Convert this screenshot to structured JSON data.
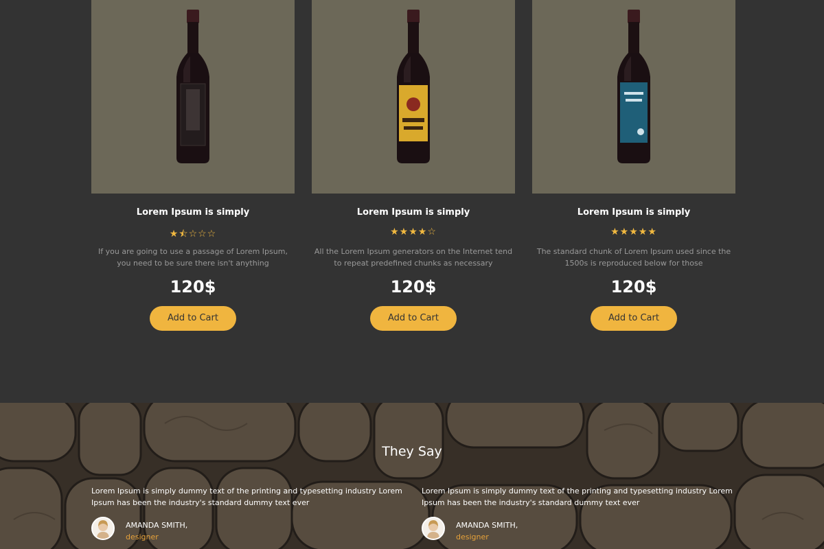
{
  "products": [
    {
      "title": "Lorem Ipsum is simply",
      "rating": 1.5,
      "stars": "★⯪☆☆☆",
      "description": "If you are going to use a passage of Lorem Ipsum, you need to be sure there isn't anything",
      "price": "120$",
      "button": "Add to Cart",
      "label_color": "#1b1b1b"
    },
    {
      "title": "Lorem Ipsum is simply",
      "rating": 4,
      "stars": "★★★★☆",
      "description": "All the Lorem Ipsum generators on the Internet tend to repeat predefined chunks as necessary",
      "price": "120$",
      "button": "Add to Cart",
      "label_color": "#d9a92c"
    },
    {
      "title": "Lorem Ipsum is simply",
      "rating": 5,
      "stars": "★★★★★",
      "description": "The standard chunk of Lorem Ipsum used since the 1500s is reproduced below for those",
      "price": "120$",
      "button": "Add to Cart",
      "label_color": "#1f5f78"
    }
  ],
  "testimonials": {
    "title": "They Say",
    "quotes": [
      {
        "text": "Lorem Ipsum is simply dummy text of the printing and typesetting industry Lorem Ipsum has been the industry's standard dummy text ever",
        "name": "AMANDA SMITH,",
        "role": "designer"
      },
      {
        "text": "Lorem Ipsum is simply dummy text of the printing and typesetting industry Lorem Ipsum has been the industry's standard dummy text ever",
        "name": "AMANDA SMITH,",
        "role": "designer"
      }
    ]
  },
  "colors": {
    "accent": "#f0b53f",
    "product_bg": "#6c6858",
    "page_bg": "#333333"
  }
}
